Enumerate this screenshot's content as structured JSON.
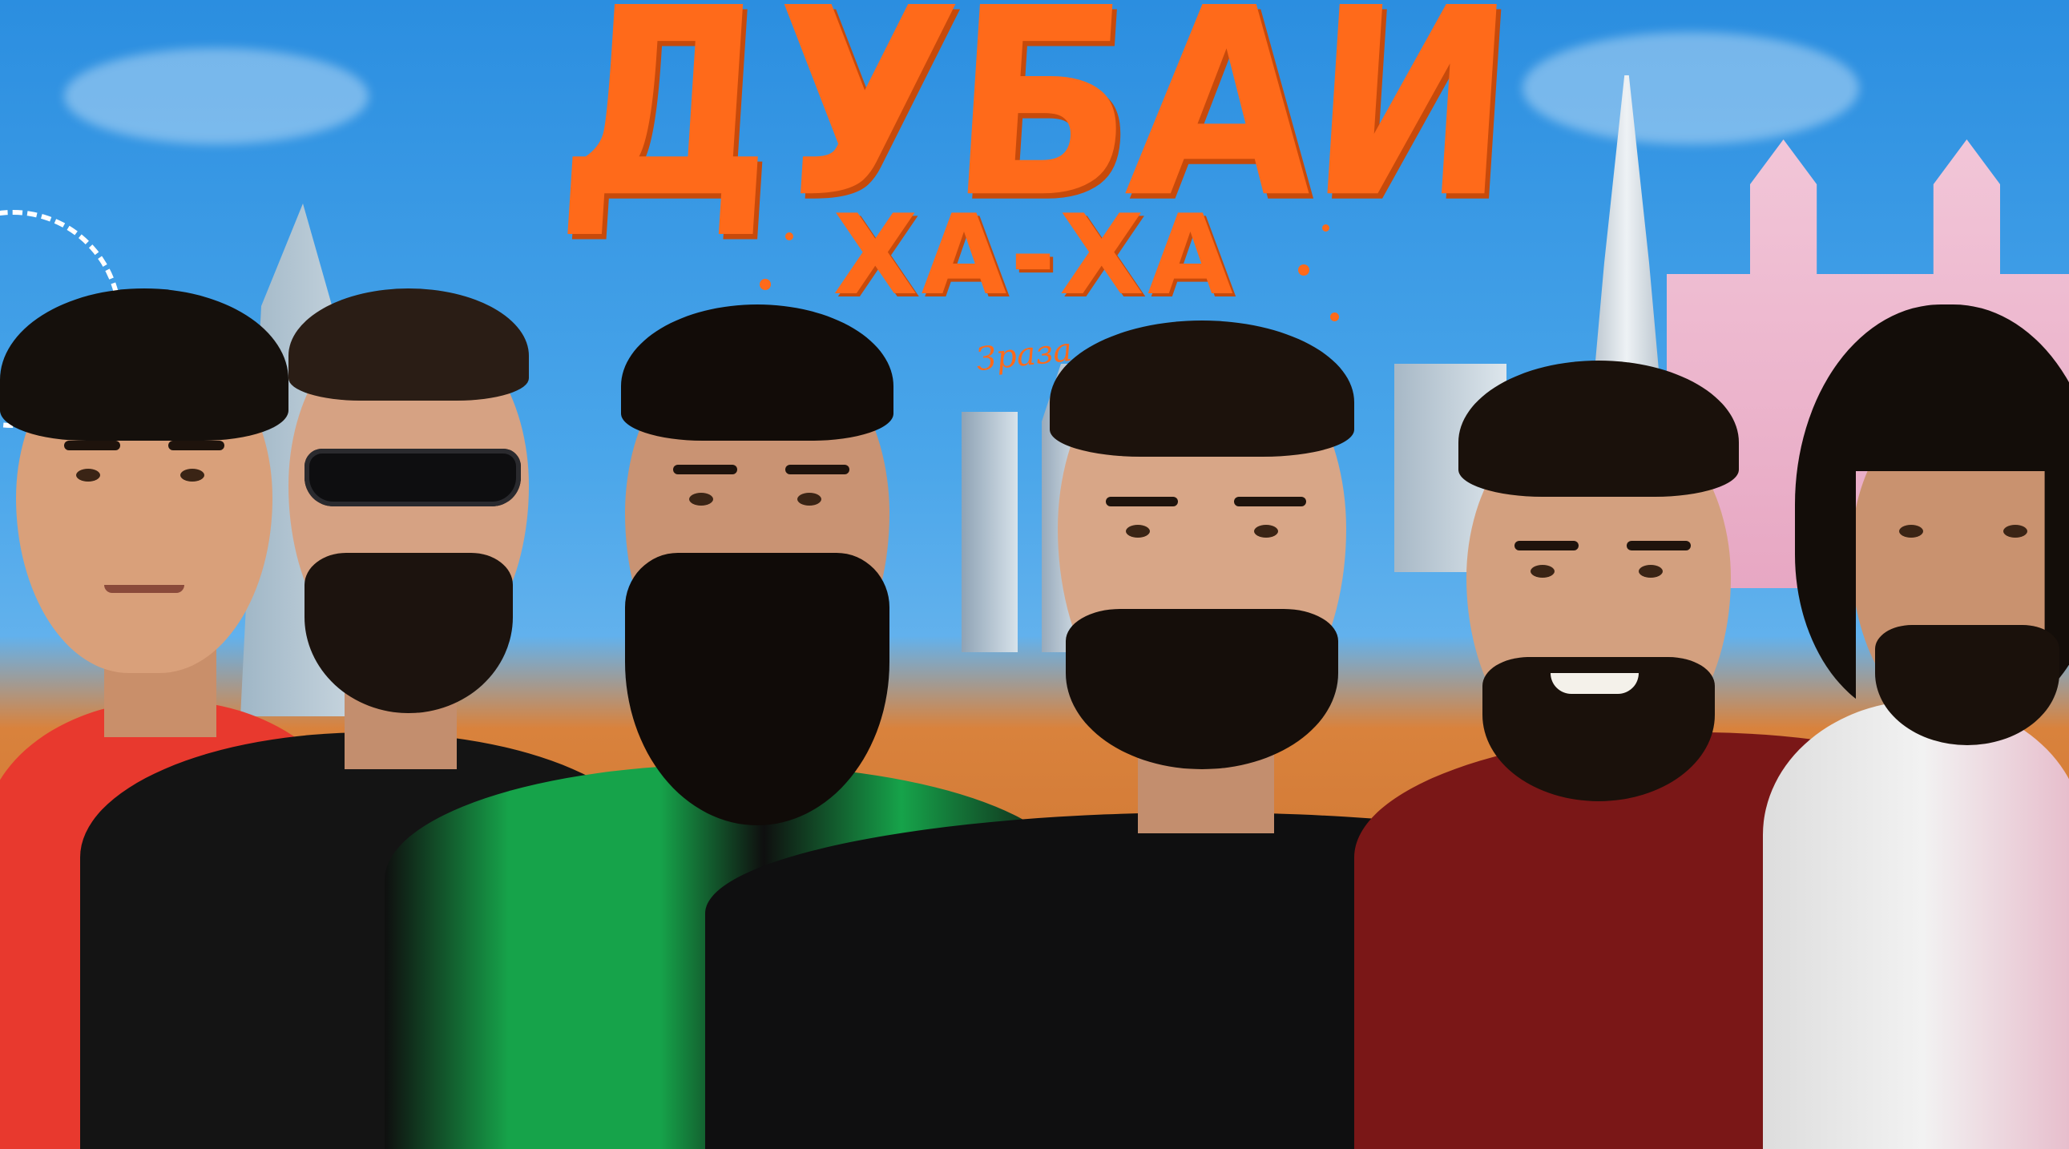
{
  "poster": {
    "title": "ДУБАЙ",
    "subtitle": "ХА-ХА",
    "signature": "Зраза"
  },
  "colors": {
    "title_orange": "#ff6a1a",
    "sky_blue": "#2b8ee0",
    "sand": "#d9823c"
  },
  "people": [
    {
      "shirt": "#e8392e"
    },
    {
      "shirt": "#141414"
    },
    {
      "shirt": "#16a34a"
    },
    {
      "shirt": "#0f0f10"
    },
    {
      "shirt": "#7a1717"
    },
    {
      "shirt": "#ececec"
    }
  ]
}
